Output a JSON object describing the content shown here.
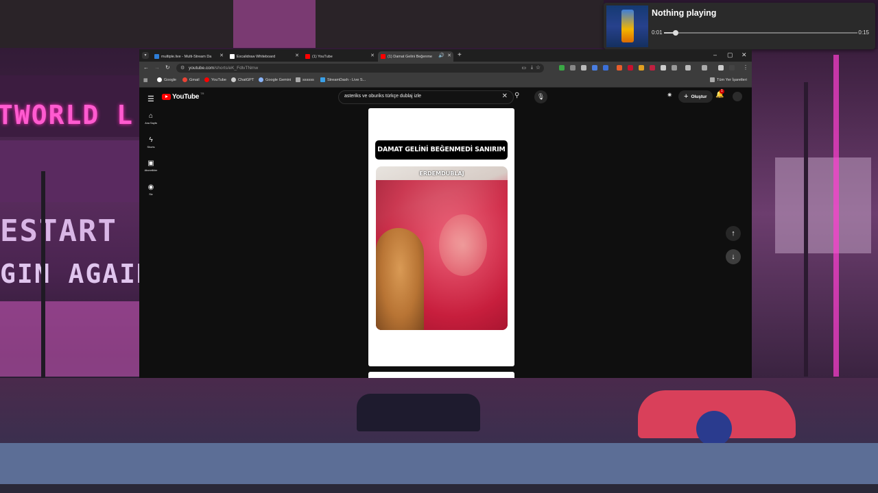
{
  "wallpaper": {
    "sign_top": "TWORLD L",
    "sign_mid1": "ESTART",
    "sign_mid2": "GIN AGAIN"
  },
  "media": {
    "title": "Nothing playing",
    "elapsed": "0:01",
    "duration": "0:15",
    "progress": 0.06
  },
  "browser": {
    "tabs": [
      {
        "label": "multiple.live - Multi-Stream Da",
        "fav": "#2e7dd7"
      },
      {
        "label": "Excalidraw Whiteboard",
        "fav": "#ffffff"
      },
      {
        "label": "(1) YouTube",
        "fav": "#ff0000"
      },
      {
        "label": "(1) Damat Gelini Beğenme",
        "fav": "#ff0000"
      }
    ],
    "url_host": "youtube.com",
    "url_path": "/shorts/eK_FdlvTNmw",
    "bookmarks": [
      {
        "label": "Google",
        "color": "#ffffff"
      },
      {
        "label": "Gmail",
        "color": "#ea4335"
      },
      {
        "label": "YouTube",
        "color": "#ff0000"
      },
      {
        "label": "ChatGPT",
        "color": "#cccccc"
      },
      {
        "label": "Google Gemini",
        "color": "#8ab4f8"
      },
      {
        "label": "ssssss",
        "color": "#aaaaaa"
      },
      {
        "label": "StreamDash - Live S...",
        "color": "#3aa0e8"
      }
    ],
    "all_bookmarks": "Tüm Yer İşaretleri"
  },
  "youtube": {
    "logo": "YouTube",
    "country": "TR",
    "search_query": "asteriks ve oburiks türkçe dublaj izle",
    "create_label": "Oluştur",
    "notif_count": "1",
    "sidebar": [
      {
        "label": "Ana Sayfa",
        "icon": "home-icon",
        "glyph": "⌂"
      },
      {
        "label": "Shorts",
        "icon": "shorts-icon",
        "glyph": "ϟ"
      },
      {
        "label": "Abonelikler",
        "icon": "subscriptions-icon",
        "glyph": "▣"
      },
      {
        "label": "Siz",
        "icon": "you-icon",
        "glyph": "◉"
      }
    ],
    "short": {
      "banner": "DAMAT GELİNİ BEĞENMEDİ SANIRIM",
      "watermark": "ERDEMDUBLAJ"
    }
  }
}
